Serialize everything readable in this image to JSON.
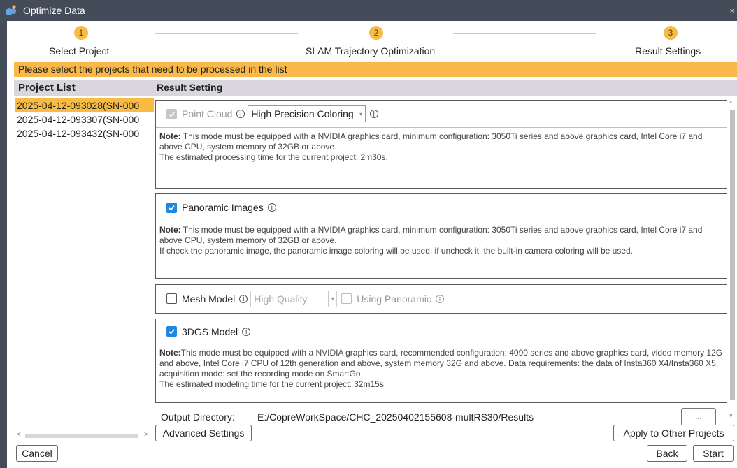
{
  "window": {
    "title": "Optimize Data",
    "close_glyph": "×"
  },
  "steps": [
    {
      "number": "1",
      "label": "Select Project"
    },
    {
      "number": "2",
      "label": "SLAM Trajectory Optimization"
    },
    {
      "number": "3",
      "label": "Result Settings"
    }
  ],
  "instruction": "Please select the projects that need to be processed in the list",
  "headers": {
    "project_list": "Project List",
    "result_setting": "Result Setting"
  },
  "projects": [
    {
      "name": "2025-04-12-093028(SN-000",
      "selected": true
    },
    {
      "name": "2025-04-12-093307(SN-000",
      "selected": false
    },
    {
      "name": "2025-04-12-093432(SN-000",
      "selected": false
    }
  ],
  "point_cloud": {
    "label": "Point Cloud",
    "checked": true,
    "disabled": true,
    "mode": "High Precision Coloring",
    "note_title": "Note:",
    "note_text": " This mode must be equipped with a NVIDIA graphics card, minimum configuration: 3050Ti series and above graphics card, Intel Core i7 and above CPU, system memory of 32GB or above.",
    "note_time": "The estimated processing time for the current project: 2m30s."
  },
  "panoramic": {
    "label": "Panoramic Images",
    "checked": true,
    "note_title": "Note:",
    "note_text": " This mode must be equipped with a NVIDIA graphics card, minimum configuration: 3050Ti series and above graphics card, Intel Core i7 and above CPU, system memory of 32GB or above.",
    "note_extra": "If check the panoramic image, the panoramic image coloring will be used; if uncheck it, the built-in camera coloring will be used."
  },
  "mesh": {
    "label": "Mesh Model",
    "checked": false,
    "quality": "High Quality",
    "using_panoramic_label": "Using Panoramic"
  },
  "gs3d": {
    "label": "3DGS Model",
    "checked": true,
    "note_title": "Note:",
    "note_text": "This mode must be equipped with a NVIDIA graphics card, recommended configuration: 4090 series and above graphics card, video memory 12G and above, Intel Core i7 CPU of 12th generation and above, system memory 32G and above. Data requirements: the data of Insta360 X4/Insta360 X5, acquisition mode: set the recording mode on SmartGo.",
    "note_time": "The estimated modeling time for the current project: 32m15s."
  },
  "output": {
    "label": "Output Directory:",
    "path": "E:/CopreWorkSpace/CHC_20250402155608-multRS30/Results",
    "browse_label": "..."
  },
  "buttons": {
    "advanced": "Advanced Settings",
    "apply_other": "Apply to Other Projects",
    "cancel": "Cancel",
    "back": "Back",
    "start": "Start"
  },
  "colors": {
    "accent": "#f8bb43",
    "checkbox": "#1e88e5",
    "titlebar": "#454c59"
  }
}
